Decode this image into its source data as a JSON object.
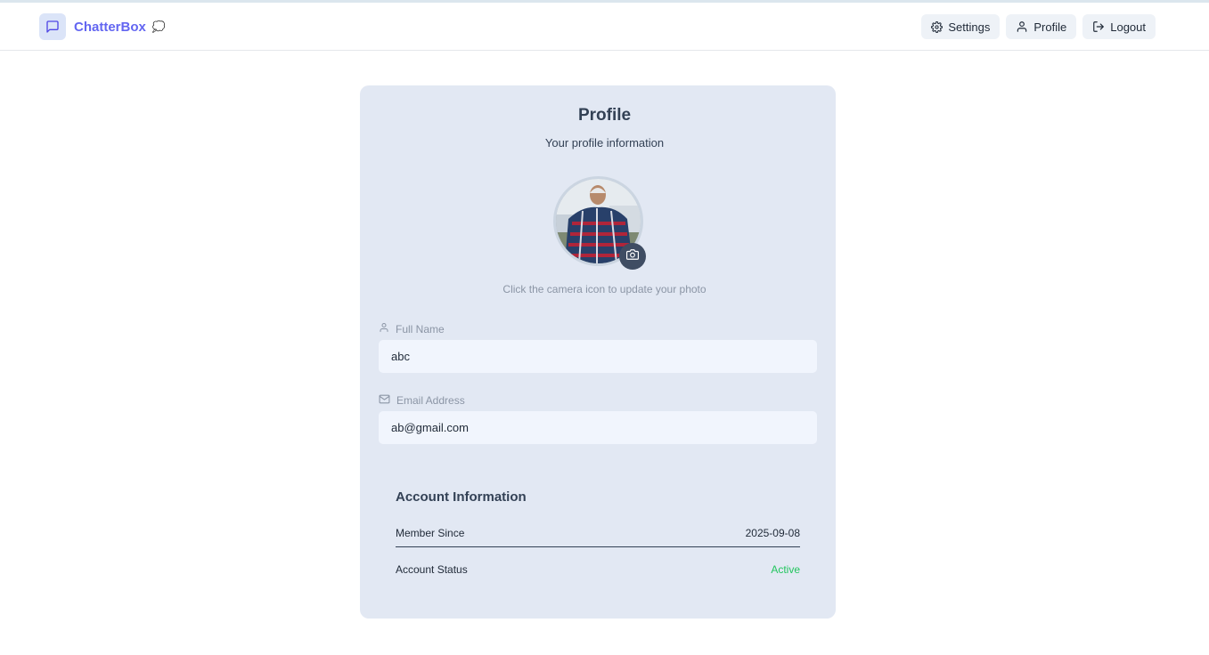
{
  "header": {
    "brand": "ChatterBox",
    "brand_emoji": "💭",
    "actions": {
      "settings": "Settings",
      "profile": "Profile",
      "logout": "Logout"
    }
  },
  "profile": {
    "title": "Profile",
    "subtitle": "Your profile information",
    "photo_hint": "Click the camera icon to update your photo",
    "fields": {
      "full_name_label": "Full Name",
      "full_name_value": "abc",
      "email_label": "Email Address",
      "email_value": "ab@gmail.com"
    },
    "account": {
      "title": "Account Information",
      "member_since_label": "Member Since",
      "member_since_value": "2025-09-08",
      "status_label": "Account Status",
      "status_value": "Active"
    }
  },
  "colors": {
    "accent": "#6366f1",
    "card_bg": "#e2e8f3",
    "status_active": "#22c55e"
  },
  "icons": [
    "message-square-icon",
    "gear-icon",
    "user-icon",
    "logout-icon",
    "camera-icon",
    "mail-icon"
  ]
}
